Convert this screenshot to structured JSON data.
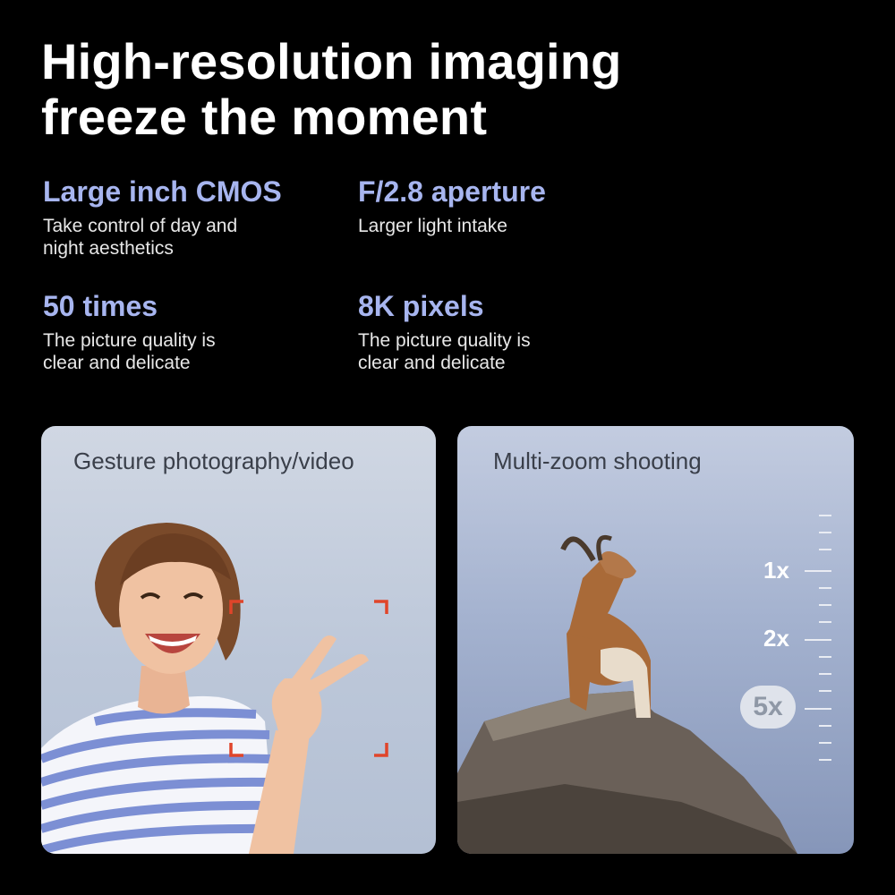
{
  "headline": {
    "line1": "High-resolution imaging",
    "line2": "freeze the moment"
  },
  "features": [
    {
      "title": "Large inch CMOS",
      "desc_line1": "Take control of day and",
      "desc_line2": "night aesthetics"
    },
    {
      "title": "F/2.8 aperture",
      "desc_line1": "Larger light intake",
      "desc_line2": ""
    },
    {
      "title": "50 times",
      "desc_line1": "The picture quality is",
      "desc_line2": "clear and delicate"
    },
    {
      "title": "8K pixels",
      "desc_line1": "The picture quality is",
      "desc_line2": "clear and delicate"
    }
  ],
  "cards": {
    "gesture": {
      "title": "Gesture photography/video"
    },
    "zoom": {
      "title": "Multi-zoom shooting",
      "levels": [
        "1x",
        "2x",
        "5x"
      ],
      "selected": "5x"
    }
  },
  "colors": {
    "background": "#000000",
    "accent": "#a7b5ef",
    "focus_bracket": "#e0452a"
  }
}
